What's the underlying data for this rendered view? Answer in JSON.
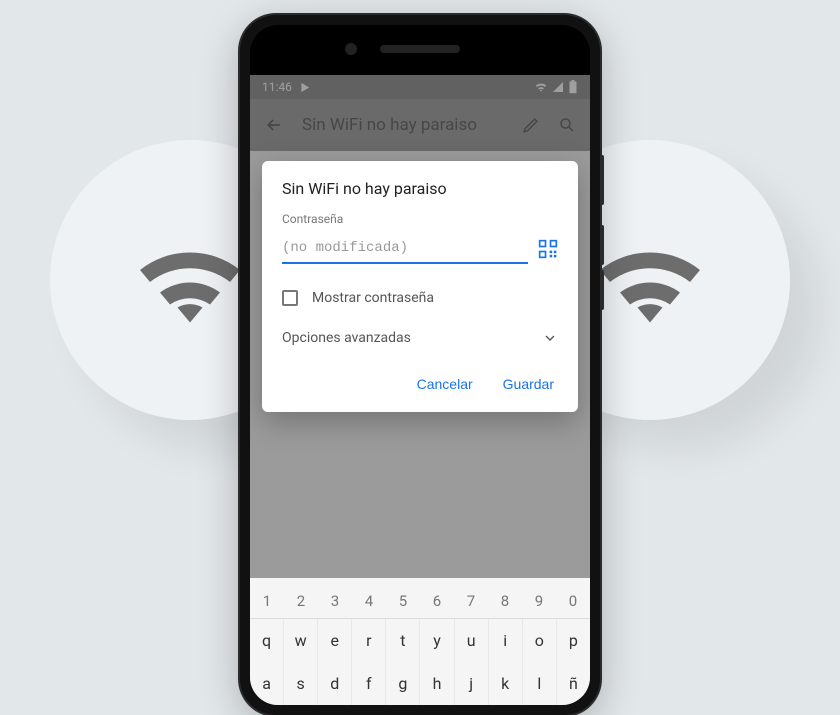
{
  "background_icon": "wifi-icon",
  "statusbar": {
    "time": "11:46",
    "icons_left": [
      "play-store-icon"
    ],
    "icons_right": [
      "wifi-signal-icon",
      "cell-signal-icon",
      "battery-icon"
    ]
  },
  "app_header": {
    "back_icon": "arrow-back-icon",
    "title": "Sin WiFi no hay paraiso",
    "edit_icon": "pencil-icon",
    "search_icon": "search-icon"
  },
  "dialog": {
    "title": "Sin WiFi no hay paraiso",
    "password_label": "Contraseña",
    "password_placeholder": "(no modificada)",
    "password_value": "",
    "qr_icon": "qr-code-icon",
    "show_password_checked": false,
    "show_password_label": "Mostrar contraseña",
    "advanced_label": "Opciones avanzadas",
    "advanced_expand_icon": "chevron-down-icon",
    "cancel_label": "Cancelar",
    "save_label": "Guardar"
  },
  "keyboard": {
    "row_numbers": [
      "1",
      "2",
      "3",
      "4",
      "5",
      "6",
      "7",
      "8",
      "9",
      "0"
    ],
    "row_qwerty": [
      "q",
      "w",
      "e",
      "r",
      "t",
      "y",
      "u",
      "i",
      "o",
      "p"
    ],
    "row_asdf": [
      "a",
      "s",
      "d",
      "f",
      "g",
      "h",
      "j",
      "k",
      "l",
      "ñ"
    ]
  },
  "colors": {
    "accent": "#1a73e8",
    "background": "#e2e7ea"
  }
}
